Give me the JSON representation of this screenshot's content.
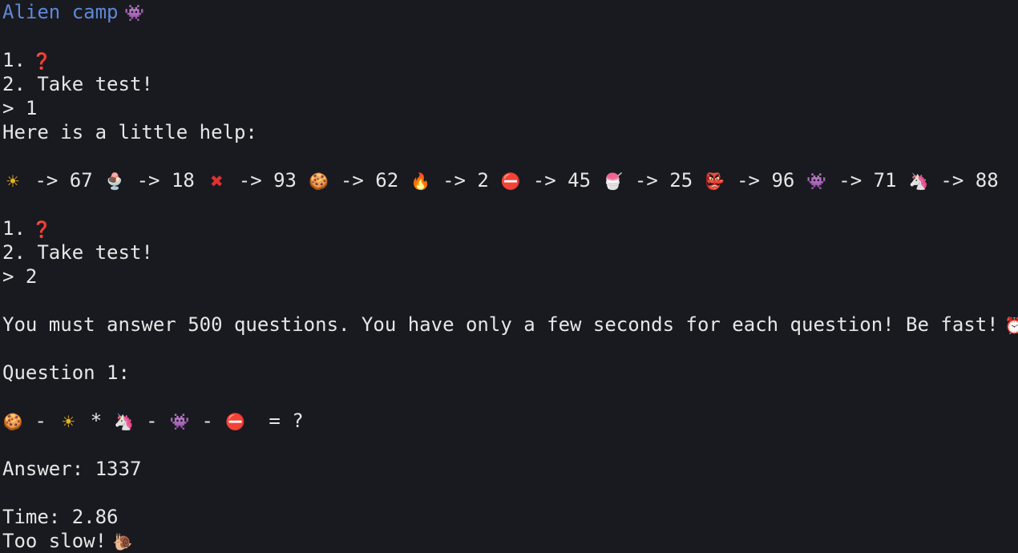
{
  "header": {
    "title": "Alien camp",
    "title_icon": "alien-monster-icon"
  },
  "menu_1": {
    "option1_prefix": "1.",
    "option1_icon": "question-mark-icon",
    "option2": "2. Take test!",
    "input": "> 1"
  },
  "help": {
    "text": "Here is a little help:",
    "mappings": [
      {
        "icon": "sun-icon",
        "glyph": "☀",
        "value": "67"
      },
      {
        "icon": "ice-cream-icon",
        "glyph": "🍨",
        "value": "18"
      },
      {
        "icon": "cross-mark-icon",
        "glyph": "✖",
        "value": "93"
      },
      {
        "icon": "cookie-icon",
        "glyph": "🍪",
        "value": "62"
      },
      {
        "icon": "fire-icon",
        "glyph": "🔥",
        "value": "2"
      },
      {
        "icon": "no-entry-icon",
        "glyph": "⛔",
        "value": "45"
      },
      {
        "icon": "shaved-ice-icon",
        "glyph": "🍧",
        "value": "25"
      },
      {
        "icon": "ogre-icon",
        "glyph": "👺",
        "value": "96"
      },
      {
        "icon": "alien-monster-icon",
        "glyph": "👾",
        "value": "71"
      },
      {
        "icon": "unicorn-icon",
        "glyph": "🦄",
        "value": "88"
      }
    ],
    "arrow": "->"
  },
  "menu_2": {
    "option1_prefix": "1.",
    "option1_icon": "question-mark-icon",
    "option2": "2. Take test!",
    "input": "> 2"
  },
  "test": {
    "intro": "You must answer 500 questions. You have only a few seconds for each question! Be fast!",
    "intro_icon": "alarm-clock-icon",
    "question_label": "Question 1:",
    "equation_tail": "= ?",
    "answer": "Answer: 1337",
    "time": "Time: 2.86",
    "result": "Too slow!",
    "result_icon": "snail-icon"
  },
  "colors": {
    "background": "#181a1f",
    "text": "#e6e6e6",
    "title": "#5f87d7"
  }
}
